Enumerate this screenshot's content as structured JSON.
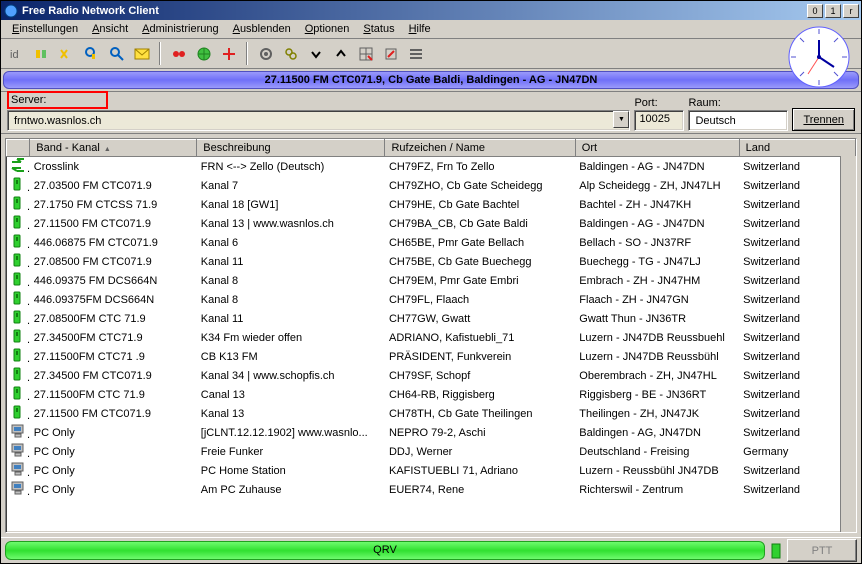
{
  "window": {
    "title": "Free Radio Network Client"
  },
  "menu": [
    "Einstellungen",
    "Ansicht",
    "Administrierung",
    "Ausblenden",
    "Optionen",
    "Status",
    "Hilfe"
  ],
  "banner": "27.11500 FM CTC071.9, Cb Gate Baldi, Baldingen - AG - JN47DN",
  "conn": {
    "server_label": "Server:",
    "server": "frntwo.wasnlos.ch",
    "port_label": "Port:",
    "port": "10025",
    "raum_label": "Raum:",
    "raum": "Deutsch",
    "trennen": "Trennen"
  },
  "columns": [
    "Band - Kanal",
    "Beschreibung",
    "Rufzeichen / Name",
    "Ort",
    "Land"
  ],
  "rows": [
    {
      "ic": "cross",
      "c0": "Crosslink",
      "c1": "FRN <--> Zello (Deutsch)",
      "c2": "CH79FZ, Frn To Zello",
      "c3": "Baldingen - AG - JN47DN",
      "c4": "Switzerland"
    },
    {
      "ic": "g",
      "c0": "27.03500 FM CTC071.9",
      "c1": "Kanal 7",
      "c2": "CH79ZHO, Cb Gate Scheidegg",
      "c3": "Alp Scheidegg - ZH, JN47LH",
      "c4": "Switzerland"
    },
    {
      "ic": "g",
      "c0": "27.1750 FM CTCSS 71.9",
      "c1": "Kanal 18 [GW1]",
      "c2": "CH79HE, Cb Gate Bachtel",
      "c3": "Bachtel - ZH - JN47KH",
      "c4": "Switzerland"
    },
    {
      "ic": "g",
      "c0": "27.11500 FM CTC071.9",
      "c1": "Kanal 13 | www.wasnlos.ch",
      "c2": "CH79BA_CB, Cb Gate Baldi",
      "c3": "Baldingen - AG - JN47DN",
      "c4": "Switzerland"
    },
    {
      "ic": "g",
      "c0": "446.06875 FM CTC071.9",
      "c1": "Kanal 6",
      "c2": "CH65BE, Pmr Gate Bellach",
      "c3": "Bellach - SO - JN37RF",
      "c4": "Switzerland"
    },
    {
      "ic": "g",
      "c0": "27.08500 FM CTC071.9",
      "c1": "Kanal 11",
      "c2": "CH75BE, Cb Gate Buechegg",
      "c3": "Buechegg - TG - JN47LJ",
      "c4": "Switzerland"
    },
    {
      "ic": "g",
      "c0": "446.09375 FM DCS664N",
      "c1": "Kanal 8",
      "c2": "CH79EM, Pmr Gate Embri",
      "c3": "Embrach - ZH - JN47HM",
      "c4": "Switzerland"
    },
    {
      "ic": "g",
      "c0": "446.09375FM DCS664N",
      "c1": "Kanal 8",
      "c2": "CH79FL, Flaach",
      "c3": "Flaach - ZH - JN47GN",
      "c4": "Switzerland"
    },
    {
      "ic": "g",
      "c0": "27.08500FM CTC 71.9",
      "c1": "Kanal 11",
      "c2": "CH77GW, Gwatt",
      "c3": "Gwatt Thun - JN36TR",
      "c4": "Switzerland"
    },
    {
      "ic": "g",
      "c0": "27.34500FM CTC71.9",
      "c1": "K34 Fm wieder offen",
      "c2": "ADRIANO, Kafistuebli_71",
      "c3": "Luzern - JN47DB Reussbuehl",
      "c4": "Switzerland"
    },
    {
      "ic": "g",
      "c0": "27.11500FM CTC71 .9",
      "c1": "CB K13 FM",
      "c2": "PRÄSIDENT, Funkverein",
      "c3": "Luzern - JN47DB Reussbühl",
      "c4": "Switzerland"
    },
    {
      "ic": "g",
      "c0": "27.34500 FM CTC071.9",
      "c1": "Kanal 34 | www.schopfis.ch",
      "c2": "CH79SF, Schopf",
      "c3": "Oberembrach - ZH, JN47HL",
      "c4": "Switzerland"
    },
    {
      "ic": "g",
      "c0": "27.11500FM CTC 71.9",
      "c1": "Canal 13",
      "c2": "CH64-RB, Riggisberg",
      "c3": "Riggisberg - BE - JN36RT",
      "c4": "Switzerland"
    },
    {
      "ic": "g",
      "c0": "27.11500 FM CTC071.9",
      "c1": "Kanal 13",
      "c2": "CH78TH, Cb Gate Theilingen",
      "c3": "Theilingen - ZH, JN47JK",
      "c4": "Switzerland"
    },
    {
      "ic": "pc",
      "c0": "PC Only",
      "c1": "[jCLNT.12.12.1902] www.wasnlo...",
      "c2": "NEPRO 79-2, Aschi",
      "c3": "Baldingen - AG, JN47DN",
      "c4": "Switzerland"
    },
    {
      "ic": "pc",
      "c0": "PC Only",
      "c1": "Freie Funker",
      "c2": "DDJ, Werner",
      "c3": "Deutschland - Freising",
      "c4": "Germany"
    },
    {
      "ic": "pc",
      "c0": "PC Only",
      "c1": "PC Home Station",
      "c2": "KAFISTUEBLI 71, Adriano",
      "c3": "Luzern - Reussbühl JN47DB",
      "c4": "Switzerland"
    },
    {
      "ic": "pc",
      "c0": "PC Only",
      "c1": "Am PC Zuhause",
      "c2": "EUER74, Rene",
      "c3": "Richterswil - Zentrum",
      "c4": "Switzerland"
    }
  ],
  "status": {
    "qrv": "QRV",
    "ptt": "PTT"
  },
  "icons": {
    "cross": "#1aa01a",
    "g": "#30d030",
    "pc": "#888888"
  }
}
